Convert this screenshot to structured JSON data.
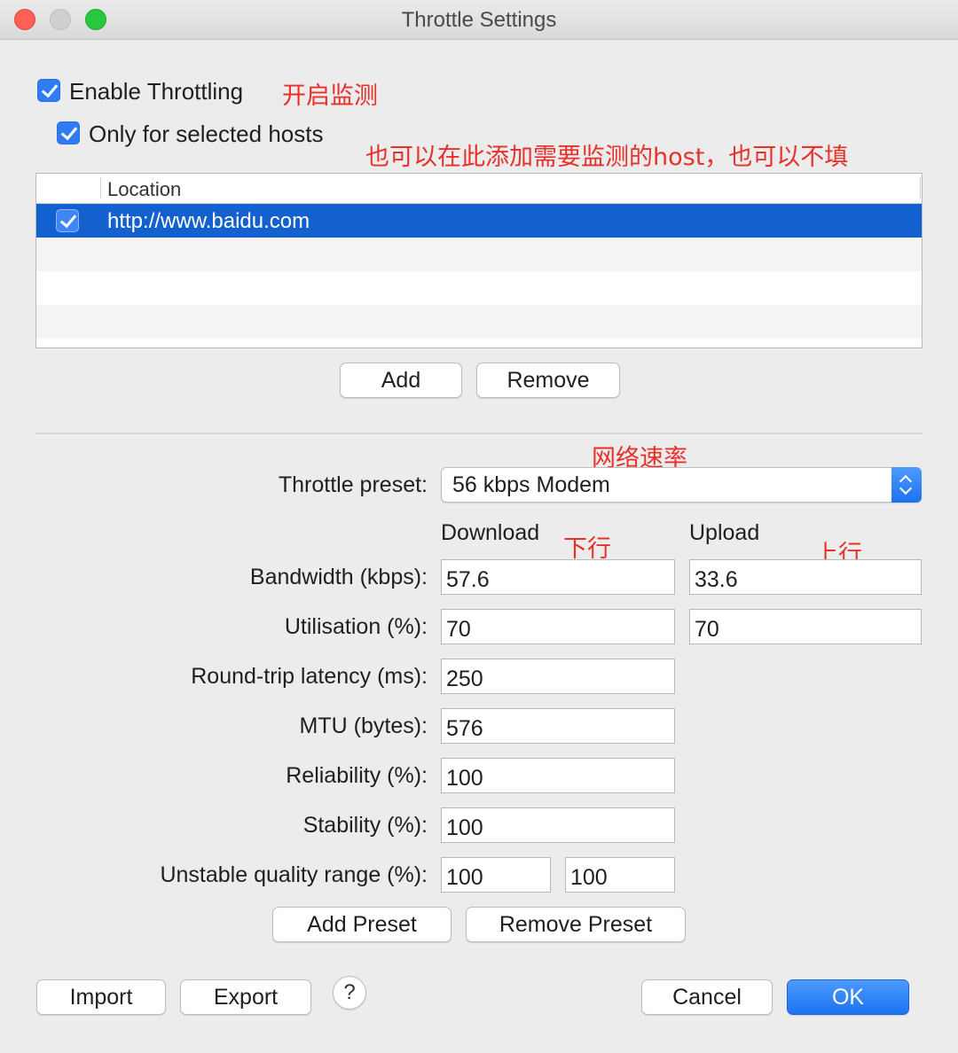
{
  "window": {
    "title": "Throttle Settings"
  },
  "options": {
    "enable_throttling": {
      "label": "Enable Throttling",
      "checked": true
    },
    "only_selected_hosts": {
      "label": "Only for selected hosts",
      "checked": true
    }
  },
  "annotations": {
    "enable": "开启监测",
    "hosts": "也可以在此添加需要监测的host，也可以不填",
    "rate": "网络速率",
    "download": "下行",
    "upload": "上行"
  },
  "hosts_table": {
    "column_header": "Location",
    "rows": [
      {
        "checked": true,
        "location": "http://www.baidu.com",
        "selected": true
      }
    ]
  },
  "host_buttons": {
    "add": "Add",
    "remove": "Remove"
  },
  "throttle": {
    "preset_label": "Throttle preset:",
    "preset_value": "56 kbps Modem",
    "download_header": "Download",
    "upload_header": "Upload",
    "bandwidth": {
      "label": "Bandwidth (kbps):",
      "download": "57.6",
      "upload": "33.6"
    },
    "utilisation": {
      "label": "Utilisation (%):",
      "download": "70",
      "upload": "70"
    },
    "latency": {
      "label": "Round-trip latency (ms):",
      "value": "250"
    },
    "mtu": {
      "label": "MTU (bytes):",
      "value": "576"
    },
    "reliability": {
      "label": "Reliability (%):",
      "value": "100"
    },
    "stability": {
      "label": "Stability (%):",
      "value": "100"
    },
    "unstable_range": {
      "label": "Unstable quality range (%):",
      "min": "100",
      "max": "100"
    }
  },
  "preset_buttons": {
    "add": "Add Preset",
    "remove": "Remove Preset"
  },
  "footer": {
    "import": "Import",
    "export": "Export",
    "help": "?",
    "cancel": "Cancel",
    "ok": "OK"
  }
}
